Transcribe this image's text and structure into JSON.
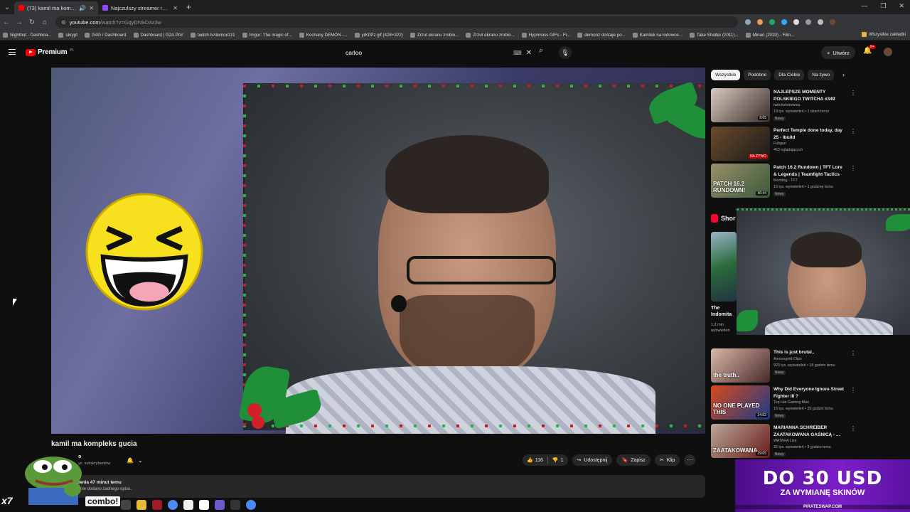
{
  "browser": {
    "tabs": [
      {
        "title": "(73) kamil ma kompleks gu",
        "active": true
      },
      {
        "title": "Najczulszy streamer roku",
        "active": false
      }
    ],
    "url_host": "youtube.com",
    "url_path": "/watch?v=GqyDN9O4z3w",
    "bookmarks": [
      "Nightbot - Dashboa...",
      "skrypt",
      "G4G / Dashboard",
      "Dashboard | G2A PAY",
      "twitch.tv/demonzz1",
      "Imgur: The magic of...",
      "Kochany DEMON -...",
      "yrK0Pz.gif (428×322)",
      "Zrzut ekranu zrobio...",
      "Zrzut ekranu zrobio...",
      "Hypnnoss GIFs - Fi...",
      "demonz dostaje po...",
      "Kamilek na lodowce...",
      "Take Shelter (2011)...",
      "Minari (2020) - Film..."
    ],
    "all_bookmarks_label": "Wszystkie zakładki"
  },
  "header": {
    "logo_label": "Premium",
    "logo_cc": "PL",
    "search_value": "carloo",
    "create_label": "Utwórz",
    "notif_badge": "9+"
  },
  "video": {
    "title": "kamil ma kompleks gucia",
    "channel_name": "o",
    "subscribers": "ys. subskrybentów",
    "likes": "116",
    "dislikes": "1",
    "share_label": "Udostępnij",
    "save_label": "Zapisz",
    "clip_label": "Klip",
    "views_line": "denia  47 minut temu",
    "description": "u nie dodano żadnego opisu."
  },
  "sidebar": {
    "chips": [
      "Wszystkie",
      "Podobne",
      "Dla Ciebie",
      "Na żywo"
    ],
    "recommendations_top": [
      {
        "title": "NAJLEPSZE MOMENTY POLSKIEGO TWITCHA #349",
        "channel": "twitchshotownia",
        "meta": "19 tys. wyświetleń • 1 dzień temu",
        "badge": "Nowy",
        "duration": "8:05",
        "colors": [
          "#d9c9c0",
          "#3b2e2a"
        ]
      },
      {
        "title": "Perfect Temple done today, day 25 - Ibuild",
        "channel": "Fubgun",
        "meta": "453 oglądających",
        "badge": "",
        "live": "NA ŻYWO",
        "colors": [
          "#6b4b2a",
          "#1a1a1a"
        ]
      },
      {
        "title": "Patch 16.2 Rundown | TFT Lore & Legends | Teamfight Tactics",
        "channel": "Mortdog - TFT",
        "meta": "16 tys. wyświetleń • 1 godzinę temu",
        "badge": "Nowy",
        "duration": "46:44",
        "thumb_text": "PATCH 16.2 RUNDOWN!",
        "colors": [
          "#9a8f6a",
          "#3a5a3a"
        ]
      }
    ],
    "shorts_label": "Shor",
    "short": {
      "title": "The Indomita",
      "views": "1,2 mln wyświetleń"
    },
    "recommendations_bottom": [
      {
        "title": "This is just brutal..",
        "channel": "Asmongold Clips",
        "meta": "923 tys. wyświetleń • 18 godzin temu",
        "badge": "Nowy",
        "thumb_text": "the truth..",
        "colors": [
          "#d8b8a8",
          "#4a2a2a"
        ]
      },
      {
        "title": "Why Did Everyone Ignore Street Fighter III ?",
        "channel": "Top Hat Gaming Man",
        "meta": "15 tys. wyświetleń • 20 godzin temu",
        "badge": "Nowy",
        "duration": "24:52",
        "thumb_text": "NO ONE PLAYED THIS",
        "colors": [
          "#d84a1a",
          "#1a3a8a"
        ]
      },
      {
        "title": "MARIANNA SCHREIBER ZAATAKOWANA GAŚNICĄ - ...",
        "channel": "WATAHA Live",
        "meta": "32 tys. wyświetleń • 9 godzin temu",
        "badge": "Nowy",
        "duration": "29:05",
        "thumb_text": "ZAATAKOWANA",
        "colors": [
          "#b8a898",
          "#6a1a1a"
        ]
      }
    ]
  },
  "overlays": {
    "combo_label": "combo!",
    "multiplier": "x7",
    "ad_line1": "DO 30 USD",
    "ad_line2": "ZA WYMIANĘ SKINÓW",
    "ad_footer": "PIRATESWAP.COM"
  },
  "colors": {
    "accent_red": "#ff0000",
    "bg": "#0f0f0f",
    "surface": "#272727",
    "ad_purple": "#7b1ec8"
  }
}
